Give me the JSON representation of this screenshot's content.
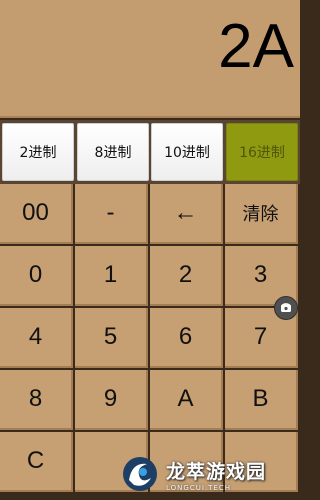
{
  "display": {
    "value": "2A"
  },
  "bases": [
    {
      "label": "2进制",
      "active": false
    },
    {
      "label": "8进制",
      "active": false
    },
    {
      "label": "10进制",
      "active": false
    },
    {
      "label": "16进制",
      "active": true
    }
  ],
  "keys": [
    [
      "00",
      "-",
      "←",
      "清除"
    ],
    [
      "0",
      "1",
      "2",
      "3"
    ],
    [
      "4",
      "5",
      "6",
      "7"
    ],
    [
      "8",
      "9",
      "A",
      "B"
    ],
    [
      "C",
      "",
      "",
      ""
    ]
  ],
  "floating_button": {
    "icon": "phone-icon"
  },
  "watermark": {
    "name": "龙萃游戏园",
    "sub": "LONGCUI.TECH"
  }
}
